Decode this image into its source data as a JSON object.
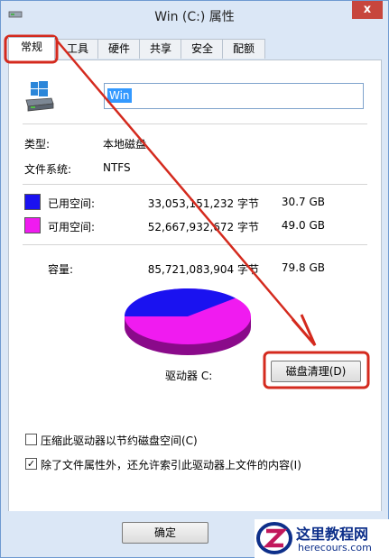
{
  "window": {
    "title": "Win (C:) 属性",
    "close_glyph": "x"
  },
  "tabs": [
    {
      "label": "常规",
      "active": true
    },
    {
      "label": "工具",
      "active": false
    },
    {
      "label": "硬件",
      "active": false
    },
    {
      "label": "共享",
      "active": false
    },
    {
      "label": "安全",
      "active": false
    },
    {
      "label": "配额",
      "active": false
    }
  ],
  "general": {
    "drive_name": "Win",
    "type_label": "类型:",
    "type_value": "本地磁盘",
    "fs_label": "文件系统:",
    "fs_value": "NTFS",
    "used_label": "已用空间:",
    "used_bytes": "33,053,151,232 字节",
    "used_size": "30.7 GB",
    "free_label": "可用空间:",
    "free_bytes": "52,667,932,672 字节",
    "free_size": "49.0 GB",
    "capacity_label": "容量:",
    "capacity_bytes": "85,721,083,904 字节",
    "capacity_size": "79.8 GB",
    "drive_label": "驱动器 C:",
    "cleanup_button": "磁盘清理(D)",
    "compress_label": "压缩此驱动器以节约磁盘空间(C)",
    "compress_checked": false,
    "index_label": "除了文件属性外，还允许索引此驱动器上文件的内容(I)",
    "index_checked": true,
    "used_color": "#1a12f0",
    "free_color": "#f01bf0",
    "used_fraction": 0.386
  },
  "footer": {
    "ok_button": "确定"
  },
  "annotation": {
    "highlight_color": "#d42a1e"
  },
  "watermark": {
    "title": "这里教程网",
    "url": "herecours.com"
  }
}
